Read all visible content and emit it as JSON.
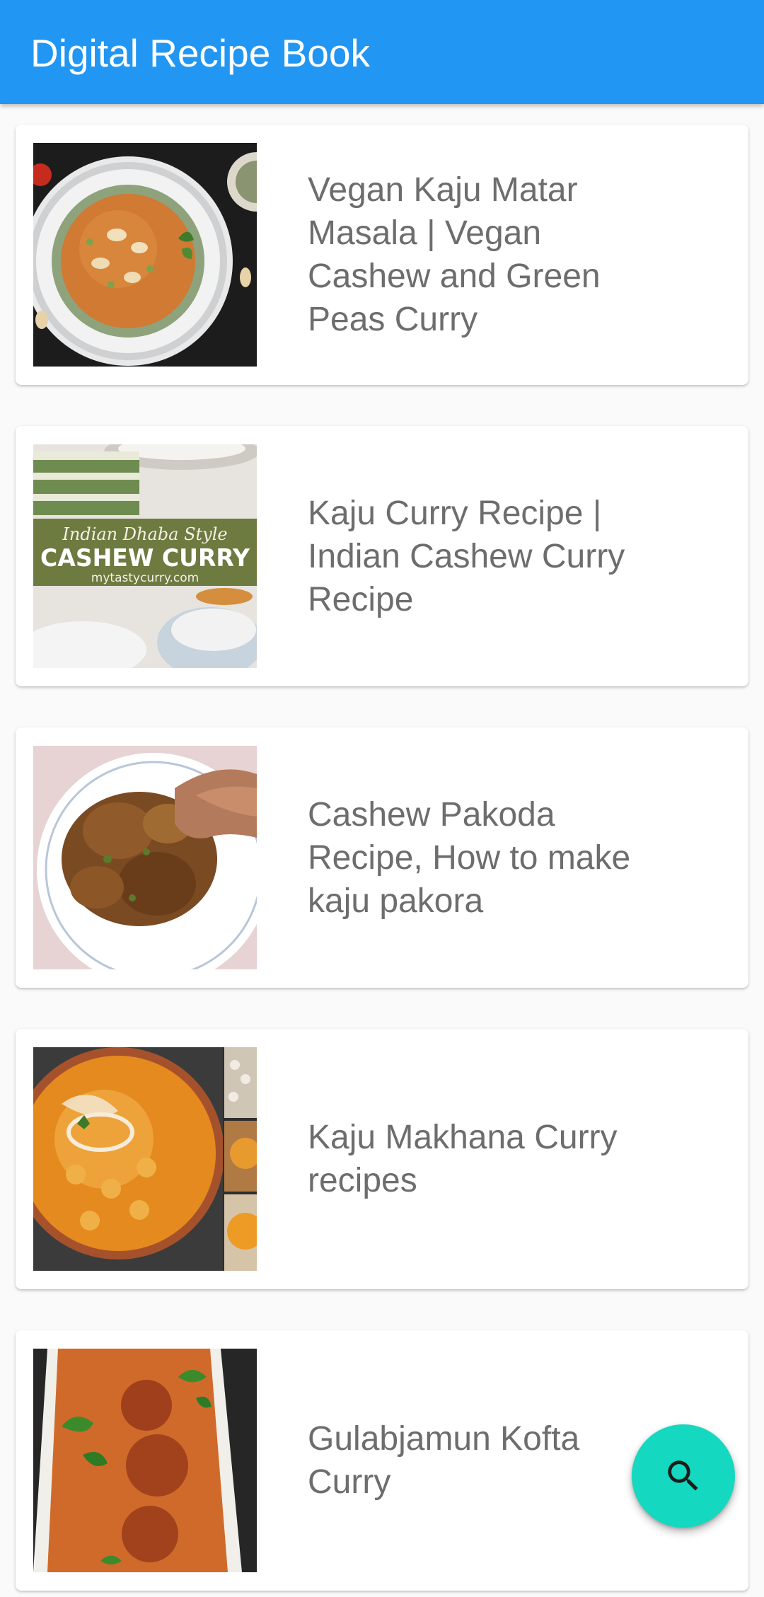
{
  "app_bar": {
    "title": "Digital Recipe Book",
    "color": "#2196f3"
  },
  "recipes": [
    {
      "title": "Vegan Kaju Matar\nMasala | Vegan\nCashew and Green\nPeas Curry",
      "image": "vegan-kaju-matar-masala-photo"
    },
    {
      "title": "Kaju Curry Recipe |\nIndian Cashew Curry\nRecipe",
      "image": "cashew-curry-photo",
      "image_text": {
        "script_line": "Indian Dhaba Style",
        "headline": "CASHEW CURRY",
        "site": "mytastycurry.com"
      }
    },
    {
      "title": "Cashew Pakoda\nRecipe, How to make\nkaju pakora",
      "image": "cashew-pakoda-photo"
    },
    {
      "title": "Kaju Makhana Curry\nrecipes",
      "image": "kaju-makhana-curry-photo"
    },
    {
      "title": "Gulabjamun Kofta\nCurry",
      "image": "gulabjamun-kofta-curry-photo"
    }
  ],
  "fab": {
    "icon": "search-icon",
    "color": "#14d8c0"
  }
}
